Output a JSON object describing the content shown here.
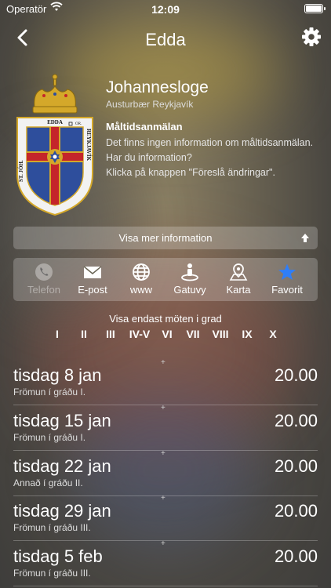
{
  "status_bar": {
    "carrier": "Operatör",
    "time": "12:09"
  },
  "nav": {
    "title": "Edda",
    "back_icon": "chevron-left-icon",
    "settings_icon": "gear-icon"
  },
  "crest": {
    "top_text": "EDDA",
    "left_text": "ST. JÓH.",
    "right_text": "REYKJAVÍK",
    "side_mark": "OR.",
    "colors": {
      "gold": "#d4a82a",
      "blue": "#2e4e9c",
      "red": "#c4252a"
    }
  },
  "lodge": {
    "title": "Johannesloge",
    "subtitle": "Austurbær Reykjavík",
    "meal_heading": "Måltidsanmälan",
    "meal_lines": [
      "Det finns ingen information om måltidsanmälan.",
      "Har du information?",
      "Klicka på knappen \"Föreslå ändringar\"."
    ]
  },
  "more_button": {
    "label": "Visa mer information",
    "icon": "arrow-up-icon"
  },
  "actions": [
    {
      "label": "Telefon",
      "icon": "phone-icon",
      "enabled": false
    },
    {
      "label": "E-post",
      "icon": "envelope-icon",
      "enabled": true
    },
    {
      "label": "www",
      "icon": "globe-icon",
      "enabled": true
    },
    {
      "label": "Gatuvy",
      "icon": "street-view-icon",
      "enabled": true
    },
    {
      "label": "Karta",
      "icon": "map-icon",
      "enabled": true
    },
    {
      "label": "Favorit",
      "icon": "star-icon",
      "enabled": true,
      "color": "#2f7ef7"
    }
  ],
  "grade_filter": {
    "title": "Visa endast möten i grad",
    "grades": [
      "I",
      "II",
      "III",
      "IV-V",
      "VI",
      "VII",
      "VIII",
      "IX",
      "X"
    ]
  },
  "meetings": [
    {
      "date": "tisdag 8 jan",
      "degree": "Frömun í gráðu I.",
      "time": "20.00",
      "marker": "+"
    },
    {
      "date": "tisdag 15 jan",
      "degree": "Frömun í gráðu I.",
      "time": "20.00",
      "marker": "+"
    },
    {
      "date": "tisdag 22 jan",
      "degree": "Annað í gráðu II.",
      "time": "20.00",
      "marker": "+"
    },
    {
      "date": "tisdag 29 jan",
      "degree": "Frömun í gráðu III.",
      "time": "20.00",
      "marker": "+"
    },
    {
      "date": "tisdag 5 feb",
      "degree": "Frömun í gráðu III.",
      "time": "20.00",
      "marker": "+"
    }
  ]
}
